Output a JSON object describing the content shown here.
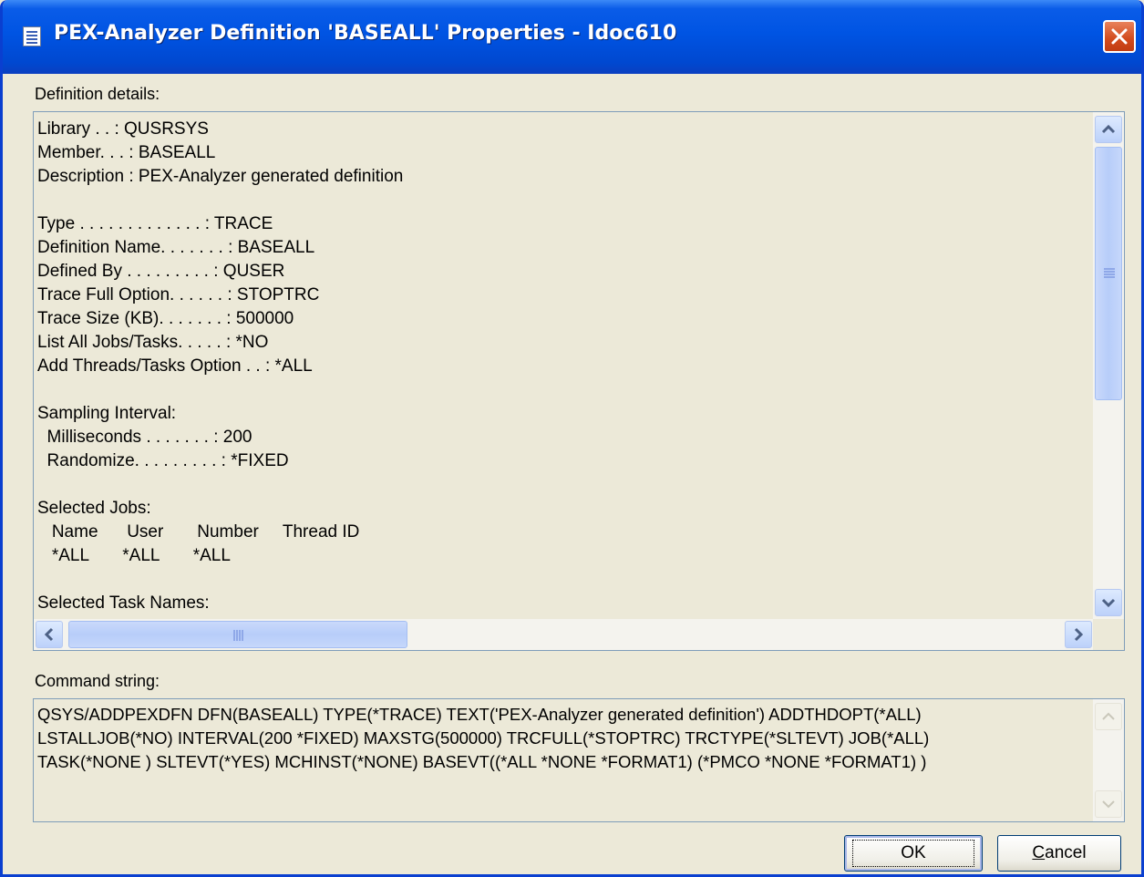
{
  "window": {
    "title": "PEX-Analyzer Definition 'BASEALL' Properties - Idoc610",
    "icon": "properties-document-icon"
  },
  "details": {
    "label": "Definition details:",
    "lines": [
      "Library . . : QUSRSYS",
      "Member. . . : BASEALL",
      "Description : PEX-Analyzer generated definition",
      "",
      "Type . . . . . . . . . . . . . : TRACE",
      "Definition Name. . . . . . . : BASEALL",
      "Defined By . . . . . . . . . : QUSER",
      "Trace Full Option. . . . . . : STOPTRC",
      "Trace Size (KB). . . . . . . : 500000",
      "List All Jobs/Tasks. . . . . : *NO",
      "Add Threads/Tasks Option . . : *ALL",
      "",
      "Sampling Interval:",
      "  Milliseconds . . . . . . . : 200",
      "  Randomize. . . . . . . . . : *FIXED",
      "",
      "Selected Jobs:",
      "   Name      User       Number     Thread ID",
      "   *ALL       *ALL       *ALL",
      "",
      "Selected Task Names:"
    ]
  },
  "command": {
    "label": "Command string:",
    "lines": [
      "QSYS/ADDPEXDFN DFN(BASEALL) TYPE(*TRACE) TEXT('PEX-Analyzer generated definition') ADDTHDOPT(*ALL)",
      "LSTALLJOB(*NO) INTERVAL(200 *FIXED) MAXSTG(500000) TRCFULL(*STOPTRC) TRCTYPE(*SLTEVT) JOB(*ALL)",
      "TASK(*NONE ) SLTEVT(*YES) MCHINST(*NONE) BASEVT((*ALL *NONE *FORMAT1) (*PMCO *NONE *FORMAT1) )"
    ]
  },
  "buttons": {
    "ok": "OK",
    "cancel": "Cancel"
  }
}
